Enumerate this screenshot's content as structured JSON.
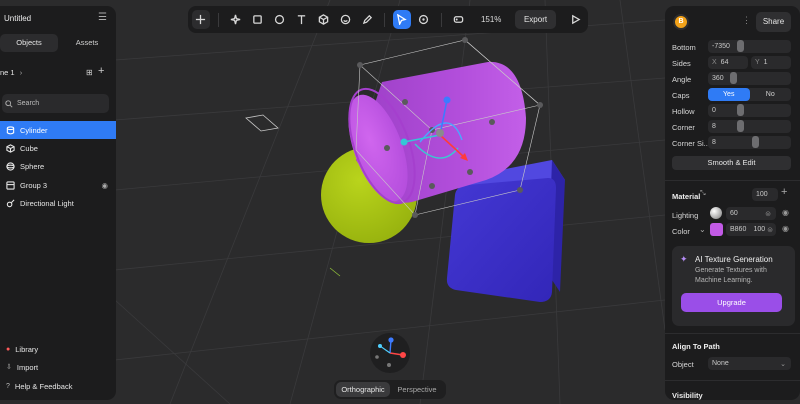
{
  "left_panel": {
    "title": "Untitled",
    "tabs": [
      "Objects",
      "Assets"
    ],
    "scene_label": "ne 1",
    "search_placeholder": "Search",
    "layers": [
      {
        "label": "Cylinder",
        "icon": "cylinder-icon",
        "selected": true
      },
      {
        "label": "Cube",
        "icon": "cube-icon",
        "selected": false
      },
      {
        "label": "Sphere",
        "icon": "sphere-icon",
        "selected": false
      },
      {
        "label": "Group 3",
        "icon": "group-icon",
        "selected": false
      },
      {
        "label": "Directional Light",
        "icon": "light-icon",
        "selected": false
      }
    ],
    "footer": [
      "Library",
      "Import",
      "Help & Feedback"
    ]
  },
  "toolbar": {
    "zoom": "151%",
    "export_label": "Export"
  },
  "right_panel": {
    "avatar_initial": "B",
    "share_label": "Share",
    "props": {
      "bottom_label": "Bottom",
      "bottom_value": "-7350",
      "sides_label": "Sides",
      "sides_x_label": "X",
      "sides_x": "64",
      "sides_y_label": "Y",
      "sides_y": "1",
      "angle_label": "Angle",
      "angle_value": "360",
      "caps_label": "Caps",
      "caps_yes": "Yes",
      "caps_no": "No",
      "hollow_label": "Hollow",
      "hollow_value": "0",
      "corner_label": "Corner",
      "corner_value": "8",
      "corner_si_label": "Corner Si...",
      "corner_si_value": "8",
      "smooth_label": "Smooth & Edit"
    },
    "material": {
      "label": "Material",
      "value": "100",
      "lighting_label": "Lighting",
      "lighting_value": "60",
      "color_label": "Color",
      "color_hex": "B860",
      "color_opacity": "100",
      "swatch": "#c25ae6"
    },
    "ai": {
      "title": "AI Texture Generation",
      "desc": "Generate Textures with Machine Learning.",
      "button": "Upgrade"
    },
    "align": {
      "title": "Align To Path",
      "object_label": "Object",
      "object_value": "None"
    },
    "visibility_label": "Visibility"
  },
  "view_tabs": [
    "Orthographic",
    "Perspective"
  ],
  "colors": {
    "accent": "#2f7bf5",
    "cylinder": "#b04ed8",
    "cube": "#3e34c9",
    "sphere": "#a8c414",
    "upgrade": "#9a4ee8"
  }
}
